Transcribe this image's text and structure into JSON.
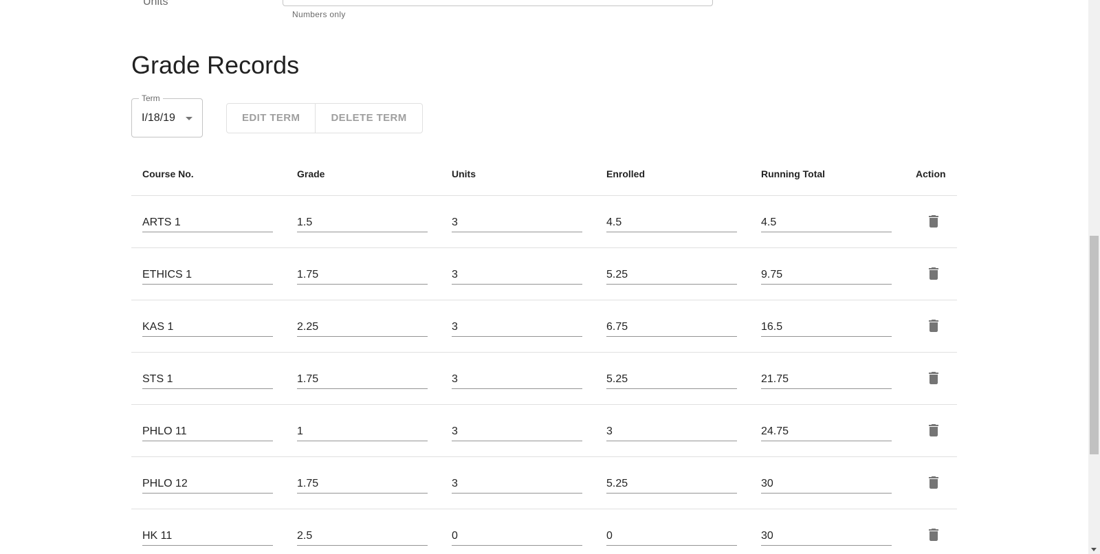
{
  "units_field": {
    "label": "Units",
    "helper": "Numbers only"
  },
  "section_title": "Grade Records",
  "term": {
    "label": "Term",
    "value": "I/18/19"
  },
  "buttons": {
    "edit_term": "EDIT TERM",
    "delete_term": "DELETE TERM"
  },
  "table": {
    "headers": {
      "course": "Course No.",
      "grade": "Grade",
      "units": "Units",
      "enrolled": "Enrolled",
      "running_total": "Running Total",
      "action": "Action"
    },
    "rows": [
      {
        "course": "ARTS 1",
        "grade": "1.5",
        "units": "3",
        "enrolled": "4.5",
        "running_total": "4.5"
      },
      {
        "course": "ETHICS 1",
        "grade": "1.75",
        "units": "3",
        "enrolled": "5.25",
        "running_total": "9.75"
      },
      {
        "course": "KAS 1",
        "grade": "2.25",
        "units": "3",
        "enrolled": "6.75",
        "running_total": "16.5"
      },
      {
        "course": "STS 1",
        "grade": "1.75",
        "units": "3",
        "enrolled": "5.25",
        "running_total": "21.75"
      },
      {
        "course": "PHLO 11",
        "grade": "1",
        "units": "3",
        "enrolled": "3",
        "running_total": "24.75"
      },
      {
        "course": "PHLO 12",
        "grade": "1.75",
        "units": "3",
        "enrolled": "5.25",
        "running_total": "30"
      },
      {
        "course": "HK 11",
        "grade": "2.5",
        "units": "0",
        "enrolled": "0",
        "running_total": "30"
      }
    ],
    "action_icon": "trash-icon"
  },
  "colors": {
    "icon": "#757575",
    "divider": "#e0e0e0",
    "disabled_text": "rgba(0,0,0,0.38)"
  }
}
